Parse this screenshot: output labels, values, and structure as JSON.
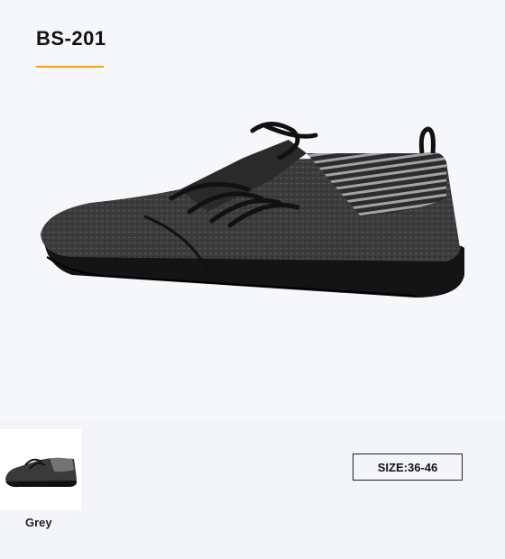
{
  "product": {
    "model": "BS-201",
    "accent_color": "#f0a418"
  },
  "variants": [
    {
      "label": "Grey",
      "selected": true
    }
  ],
  "size_tag": "SIZE:36-46",
  "image": {
    "subject": "shoe-side-view",
    "colors": {
      "upper": "#3a3a3a",
      "sole": "#111111",
      "stripes": "#9a9a9a"
    }
  }
}
